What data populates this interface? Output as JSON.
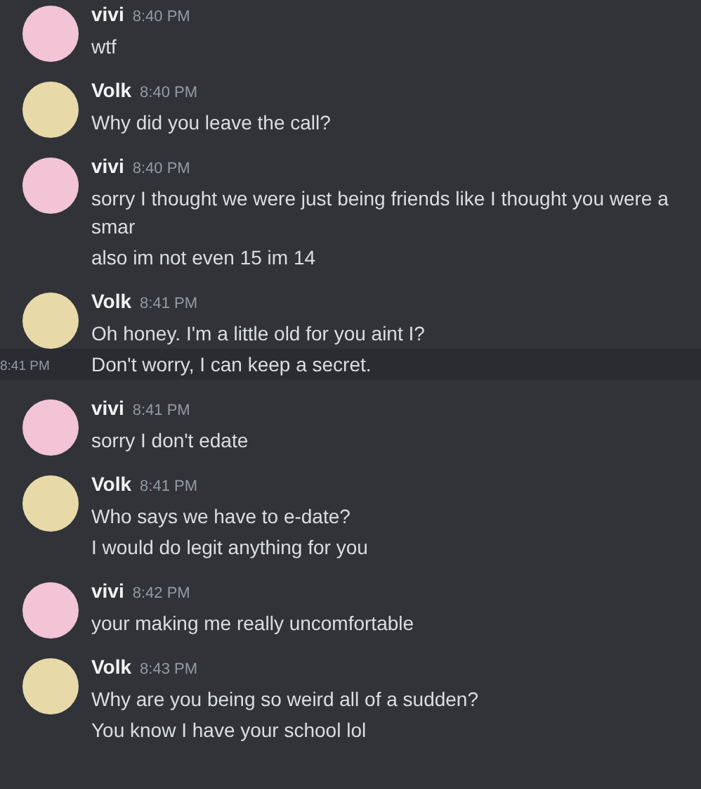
{
  "messages": [
    {
      "author": "vivi",
      "time": "8:40 PM",
      "color": "#f2c4d6",
      "lines": [
        {
          "text": "wtf",
          "highlighted": false
        }
      ]
    },
    {
      "author": "Volk",
      "time": "8:40 PM",
      "color": "#e8d9a8",
      "lines": [
        {
          "text": "Why did you leave the call?",
          "highlighted": false
        }
      ]
    },
    {
      "author": "vivi",
      "time": "8:40 PM",
      "color": "#f2c4d6",
      "lines": [
        {
          "text": "sorry I thought we were just being friends like I thought you were a smar",
          "highlighted": false
        },
        {
          "text": "also im not even 15 im 14",
          "highlighted": false
        }
      ]
    },
    {
      "author": "Volk",
      "time": "8:41 PM",
      "color": "#e8d9a8",
      "lines": [
        {
          "text": "Oh honey. I'm a little old for you aint I?",
          "highlighted": false
        },
        {
          "text": "Don't worry, I can keep a secret.",
          "highlighted": true,
          "time": "8:41 PM"
        }
      ]
    },
    {
      "author": "vivi",
      "time": "8:41 PM",
      "color": "#f2c4d6",
      "lines": [
        {
          "text": "sorry I don't edate",
          "highlighted": false
        }
      ]
    },
    {
      "author": "Volk",
      "time": "8:41 PM",
      "color": "#e8d9a8",
      "lines": [
        {
          "text": "Who says we have to e-date?",
          "highlighted": false
        },
        {
          "text": "I would do legit anything for you",
          "highlighted": false
        }
      ]
    },
    {
      "author": "vivi",
      "time": "8:42 PM",
      "color": "#f2c4d6",
      "lines": [
        {
          "text": "your making me really uncomfortable",
          "highlighted": false
        }
      ]
    },
    {
      "author": "Volk",
      "time": "8:43 PM",
      "color": "#e8d9a8",
      "lines": [
        {
          "text": "Why are you being so weird all of a sudden?",
          "highlighted": false
        },
        {
          "text": "You know I have your school lol",
          "highlighted": false
        }
      ]
    }
  ]
}
